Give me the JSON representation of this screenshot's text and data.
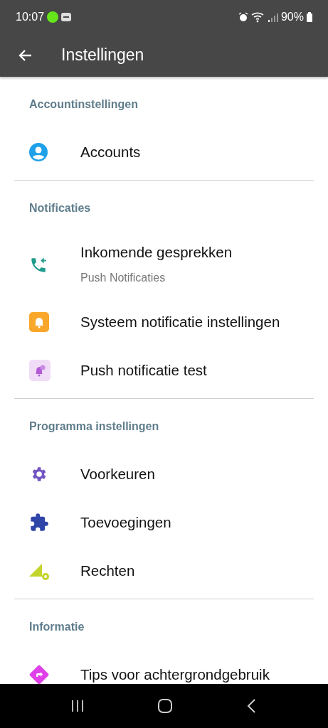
{
  "status_bar": {
    "time": "10:07",
    "battery": "90%"
  },
  "app_bar": {
    "title": "Instellingen"
  },
  "sections": [
    {
      "title": "Accountinstellingen",
      "items": [
        {
          "label": "Accounts"
        }
      ]
    },
    {
      "title": "Notificaties",
      "items": [
        {
          "label": "Inkomende gesprekken",
          "subtitle": "Push Notificaties"
        },
        {
          "label": "Systeem notificatie instellingen"
        },
        {
          "label": "Push notificatie test"
        }
      ]
    },
    {
      "title": "Programma instellingen",
      "items": [
        {
          "label": "Voorkeuren"
        },
        {
          "label": "Toevoegingen"
        },
        {
          "label": "Rechten"
        }
      ]
    },
    {
      "title": "Informatie",
      "items": [
        {
          "label": "Tips voor achtergrondgebruik"
        }
      ]
    }
  ]
}
